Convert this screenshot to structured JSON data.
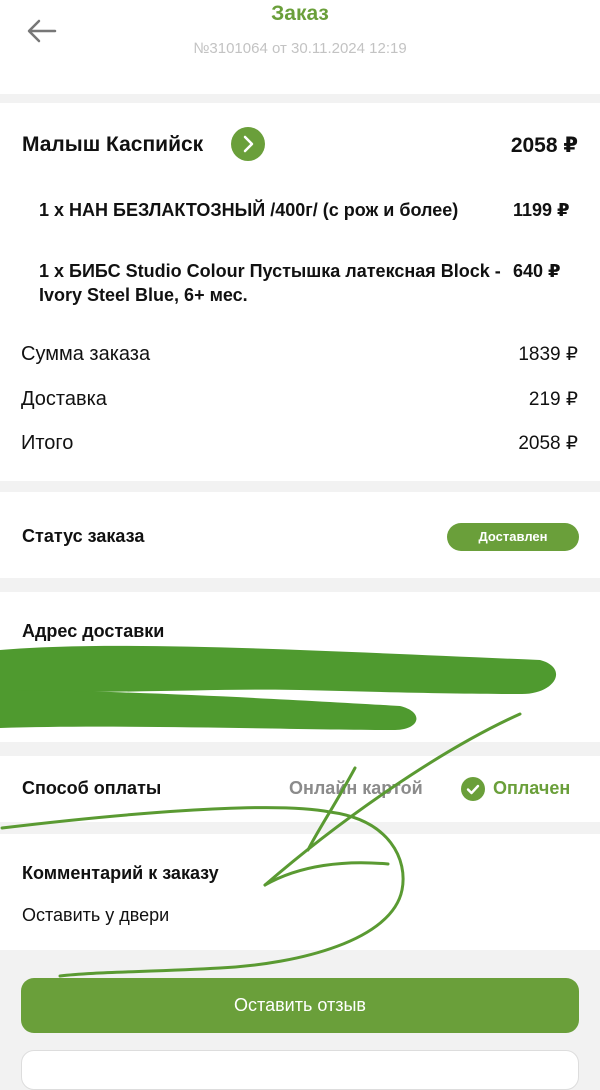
{
  "header": {
    "title": "Заказ",
    "subtitle": "№3101064 от 30.11.2024 12:19",
    "back_icon": "arrow-left-icon"
  },
  "order": {
    "store_name": "Малыш Каспийск",
    "store_total": "2058 ₽",
    "items": [
      {
        "name": "1 x НАН БЕЗЛАКТОЗНЫЙ /400г/ (с рож и более)",
        "price": "1199 ₽"
      },
      {
        "name": "1 x БИБС Studio Colour Пустышка латексная Block - Ivory Steel Blue, 6+ мес.",
        "price": "640 ₽"
      }
    ],
    "summary": [
      {
        "label": "Сумма заказа",
        "value": "1839 ₽"
      },
      {
        "label": "Доставка",
        "value": "219 ₽"
      },
      {
        "label": "Итого",
        "value": "2058 ₽"
      }
    ]
  },
  "status": {
    "label": "Статус заказа",
    "value": "Доставлен"
  },
  "address": {
    "label": "Адрес доставки"
  },
  "payment": {
    "label": "Способ оплаты",
    "method": "Онлайн картой",
    "state": "Оплачен",
    "state_icon": "check-circle-icon"
  },
  "comment": {
    "label": "Комментарий к заказу",
    "text": "Оставить у двери"
  },
  "actions": {
    "review_button": "Оставить отзыв"
  },
  "colors": {
    "accent": "#6a9f3a",
    "muted": "#8b8b8b",
    "background": "#f2f2f2"
  }
}
